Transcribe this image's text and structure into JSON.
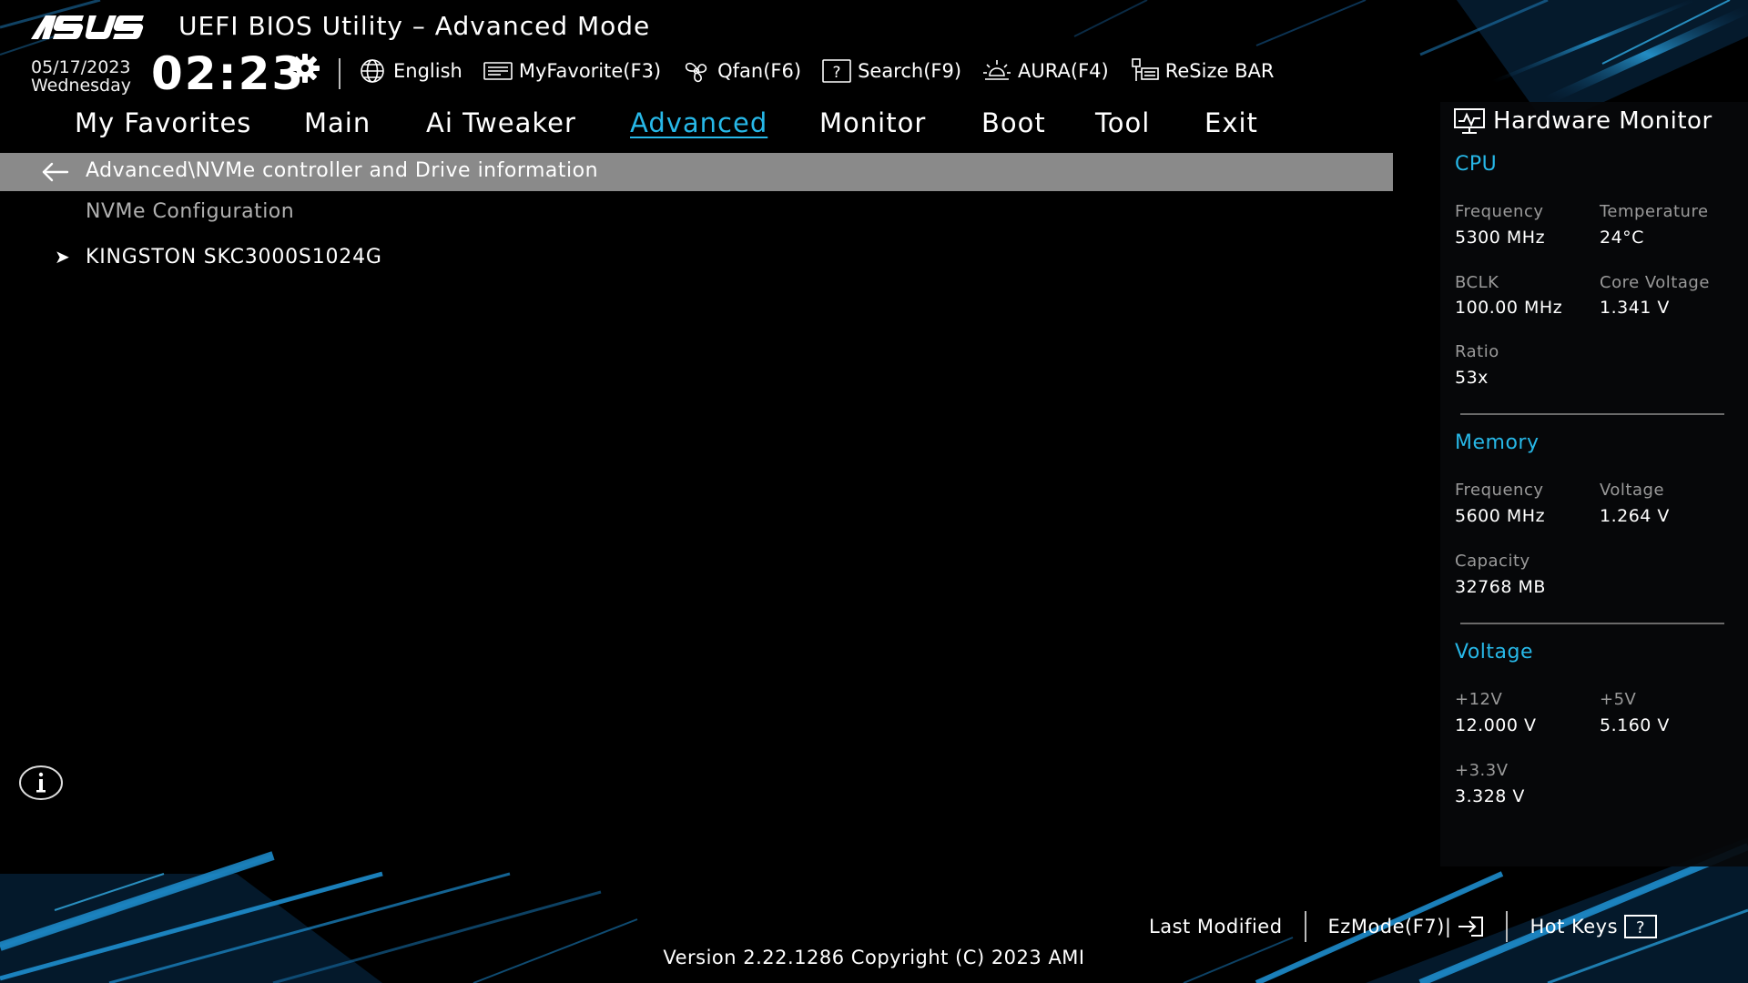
{
  "app": {
    "brand": "ASUS",
    "title": "UEFI BIOS Utility – Advanced Mode"
  },
  "status": {
    "date": "05/17/2023",
    "weekday": "Wednesday",
    "time": "02:23"
  },
  "toolbar": {
    "items": [
      {
        "label": "English",
        "icon": "globe-icon"
      },
      {
        "label": "MyFavorite(F3)",
        "icon": "favorite-icon"
      },
      {
        "label": "Qfan(F6)",
        "icon": "fan-icon"
      },
      {
        "label": "Search(F9)",
        "icon": "search-icon"
      },
      {
        "label": "AURA(F4)",
        "icon": "aura-icon"
      },
      {
        "label": "ReSize BAR",
        "icon": "resize-bar-icon"
      }
    ]
  },
  "nav": {
    "tabs": [
      {
        "label": "My Favorites"
      },
      {
        "label": "Main"
      },
      {
        "label": "Ai Tweaker"
      },
      {
        "label": "Advanced",
        "active": true
      },
      {
        "label": "Monitor"
      },
      {
        "label": "Boot"
      },
      {
        "label": "Tool"
      },
      {
        "label": "Exit"
      }
    ]
  },
  "main": {
    "breadcrumb": "Advanced\\NVMe controller and Drive information",
    "section_label": "NVMe Configuration",
    "items": [
      {
        "label": "KINGSTON SKC3000S1024G"
      }
    ]
  },
  "hw_monitor": {
    "title": "Hardware Monitor",
    "cpu": {
      "title": "CPU",
      "frequency_label": "Frequency",
      "frequency": "5300 MHz",
      "temperature_label": "Temperature",
      "temperature": "24°C",
      "bclk_label": "BCLK",
      "bclk": "100.00 MHz",
      "core_voltage_label": "Core Voltage",
      "core_voltage": "1.341 V",
      "ratio_label": "Ratio",
      "ratio": "53x"
    },
    "memory": {
      "title": "Memory",
      "frequency_label": "Frequency",
      "frequency": "5600 MHz",
      "voltage_label": "Voltage",
      "voltage": "1.264 V",
      "capacity_label": "Capacity",
      "capacity": "32768 MB"
    },
    "voltage": {
      "title": "Voltage",
      "v12_label": "+12V",
      "v12": "12.000 V",
      "v5_label": "+5V",
      "v5": "5.160 V",
      "v33_label": "+3.3V",
      "v33": "3.328 V"
    }
  },
  "footer": {
    "last_modified": "Last Modified",
    "ezmode": "EzMode(F7)|",
    "hot_keys": "Hot Keys",
    "version": "Version 2.22.1286 Copyright (C) 2023 AMI"
  },
  "colors": {
    "accent": "#27b8e8",
    "breadcrumb_bg": "#8a8a8a",
    "background": "#000000"
  }
}
